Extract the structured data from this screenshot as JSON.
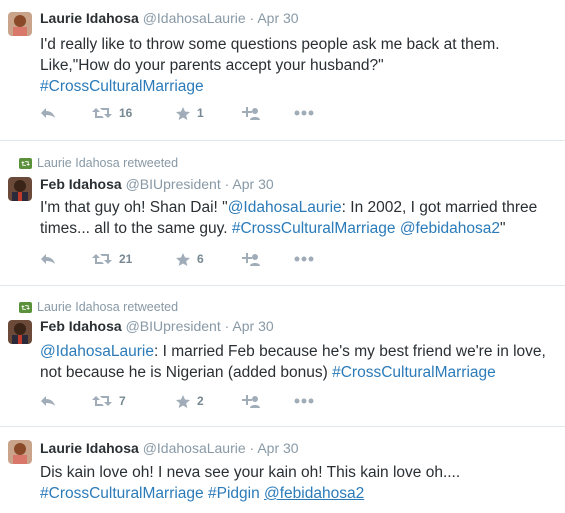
{
  "tweets": [
    {
      "retweet_label": "",
      "name": "Laurie Idahosa",
      "handle": "@IdahosaLaurie",
      "dot": "·",
      "time": "Apr 30",
      "line1": "I'd really like to throw some questions people ask me back at them.",
      "line2": "Like,\"How do your parents accept your husband?\"",
      "tag1": "#CrossCulturalMarriage",
      "retweets": "16",
      "favorites": "1"
    },
    {
      "retweet_label": "Laurie Idahosa retweeted",
      "name": "Feb Idahosa",
      "handle": "@BIUpresident",
      "dot": "·",
      "time": "Apr 30",
      "pre": "I'm that guy oh! Shan Dai! \"",
      "mention1": "@IdahosaLaurie",
      "post": ": In 2002, I got married three",
      "line2_pre": "times... all to the same guy. ",
      "tag1": "#CrossCulturalMarriage",
      "mention2": "@febidahosa2",
      "end": "\"",
      "retweets": "21",
      "favorites": "6"
    },
    {
      "retweet_label": "Laurie Idahosa retweeted",
      "name": "Feb Idahosa",
      "handle": "@BIUpresident",
      "dot": "·",
      "time": "Apr 30",
      "mention1": "@IdahosaLaurie",
      "post": ": I married Feb because he's my best friend we're in love,",
      "line2_pre": "not because he is Nigerian (added bonus) ",
      "tag1": "#CrossCulturalMarriage",
      "retweets": "7",
      "favorites": "2"
    },
    {
      "retweet_label": "",
      "name": "Laurie Idahosa",
      "handle": "@IdahosaLaurie",
      "dot": "·",
      "time": "Apr 30",
      "line1": "Dis kain love oh! I neva see your kain oh! This kain love oh....",
      "tag1": "#CrossCulturalMarriage",
      "tag2": "#Pidgin",
      "mention1": "@febidahosa2"
    }
  ],
  "colors": {
    "link": "#2b7bb9",
    "muted": "#8899a6",
    "retweet_green": "#5c913b"
  }
}
